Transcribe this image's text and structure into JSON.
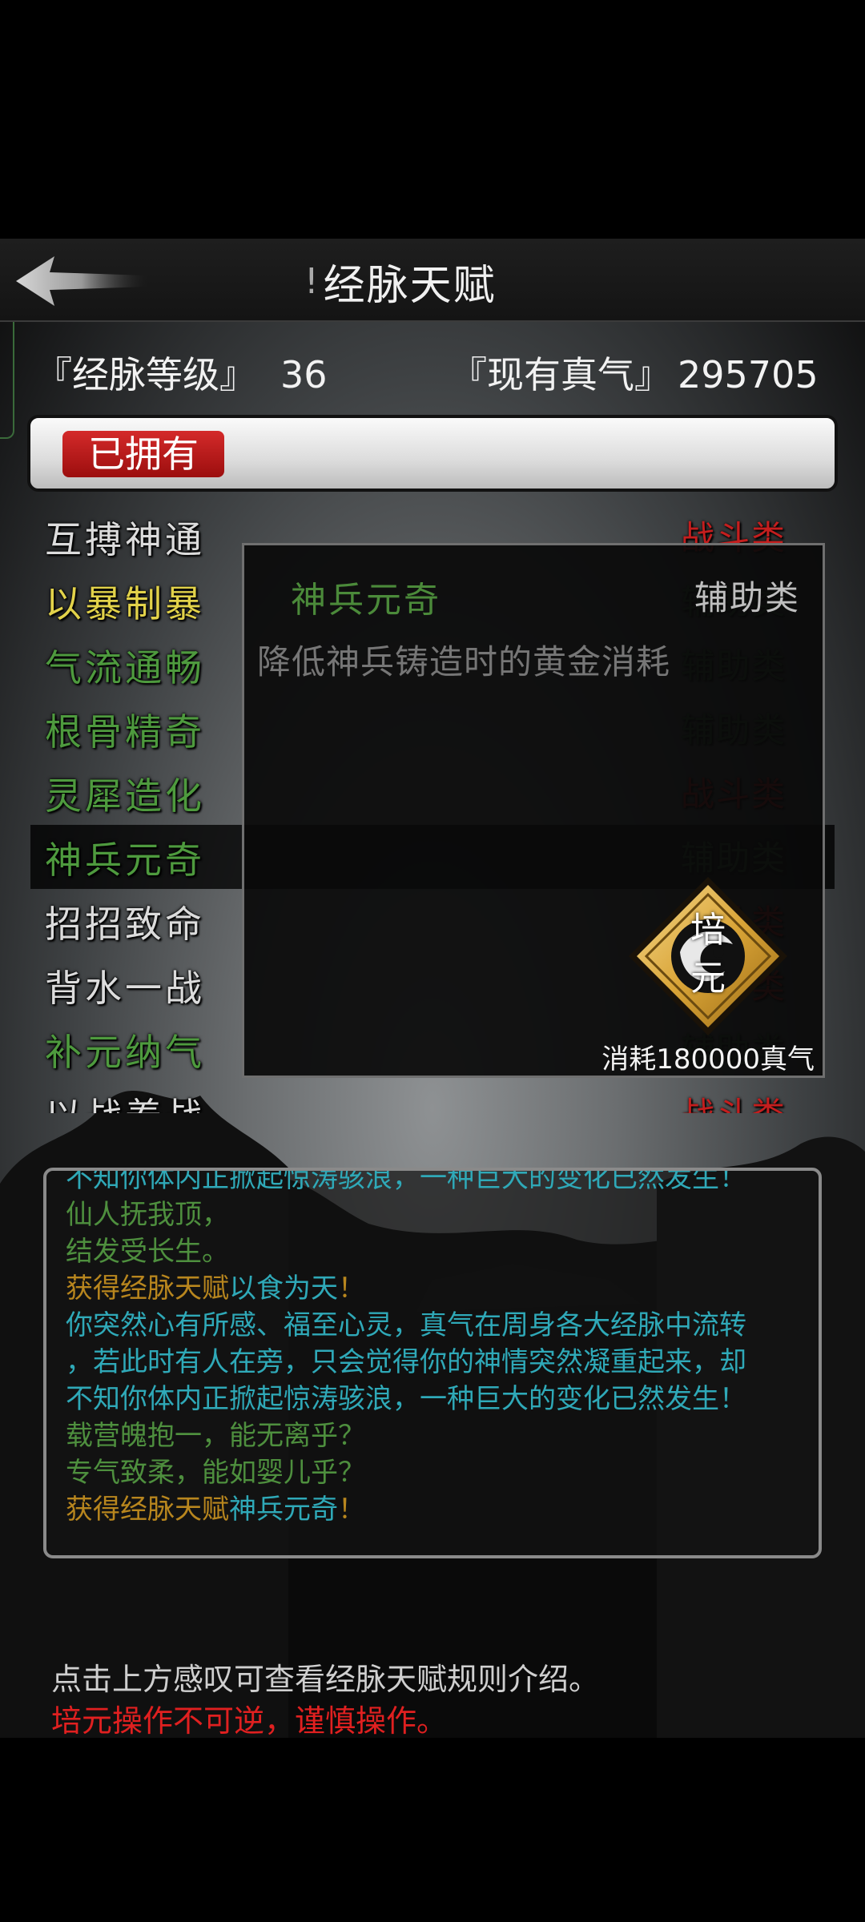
{
  "header": {
    "title": "经脉天赋",
    "info_icon": "!"
  },
  "stats": {
    "level_label": "『经脉等级』",
    "level_value": "36",
    "qi_label": "『现有真气』",
    "qi_value": "295705"
  },
  "filter": {
    "owned_label": "已拥有"
  },
  "talents": [
    {
      "name": "互搏神通",
      "category": "战斗类",
      "name_color": "#dcdcdc",
      "cat_color": "#c41e1e"
    },
    {
      "name": "以暴制暴",
      "category": "辅助类",
      "name_color": "#e2d24a",
      "cat_color": "#2e5a2e"
    },
    {
      "name": "气流通畅",
      "category": "辅助类",
      "name_color": "#4e9a3e",
      "cat_color": "#2e5a2e"
    },
    {
      "name": "根骨精奇",
      "category": "辅助类",
      "name_color": "#4e9a3e",
      "cat_color": "#2e5a2e"
    },
    {
      "name": "灵犀造化",
      "category": "战斗类",
      "name_color": "#4e9a3e",
      "cat_color": "#c41e1e"
    },
    {
      "name": "神兵元奇",
      "category": "辅助类",
      "name_color": "#4e9a3e",
      "cat_color": "#2e5a2e"
    },
    {
      "name": "招招致命",
      "category": "战斗类",
      "name_color": "#dcdcdc",
      "cat_color": "#c41e1e"
    },
    {
      "name": "背水一战",
      "category": "战斗类",
      "name_color": "#dcdcdc",
      "cat_color": "#c41e1e"
    },
    {
      "name": "补元纳气",
      "category": "辅助类",
      "name_color": "#4e9a3e",
      "cat_color": "#2e5a2e"
    },
    {
      "name": "以战养战",
      "category": "战斗类",
      "name_color": "#dcdcdc",
      "cat_color": "#c41e1e"
    }
  ],
  "selected_index": 5,
  "detail": {
    "name": "神兵元奇",
    "category": "辅助类",
    "description": "降低神兵铸造时的黄金消耗",
    "action_label_1": "培",
    "action_label_2": "元",
    "cost": "消耗180000真气"
  },
  "log": [
    {
      "text": "不知你体内正掀起惊涛骇浪，一种巨大的变化已然发生！",
      "color": "#2fa9b8"
    },
    {
      "text": "仙人抚我顶，",
      "color": "#4e8f3e"
    },
    {
      "text": "结发受长生。",
      "color": "#4e8f3e"
    },
    {
      "parts": [
        {
          "text": "获得经脉天赋",
          "color": "#b8861e"
        },
        {
          "text": "以食为天",
          "color": "#2fa9b8"
        },
        {
          "text": "！",
          "color": "#b8861e"
        }
      ]
    },
    {
      "text": "你突然心有所感、福至心灵，真气在周身各大经脉中流转",
      "color": "#2fa9b8"
    },
    {
      "text": "，若此时有人在旁，只会觉得你的神情突然凝重起来，却",
      "color": "#2fa9b8"
    },
    {
      "text": "不知你体内正掀起惊涛骇浪，一种巨大的变化已然发生！",
      "color": "#2fa9b8"
    },
    {
      "text": "载营魄抱一，能无离乎？",
      "color": "#4e8f3e"
    },
    {
      "text": "专气致柔，能如婴儿乎？",
      "color": "#4e8f3e"
    },
    {
      "parts": [
        {
          "text": "获得经脉天赋",
          "color": "#b8861e"
        },
        {
          "text": "神兵元奇",
          "color": "#2fa9b8"
        },
        {
          "text": "！",
          "color": "#b8861e"
        }
      ]
    }
  ],
  "footer": {
    "hint_info": "点击上方感叹可查看经脉天赋规则介绍。",
    "hint_warning": "培元操作不可逆，谨慎操作。"
  },
  "icons": {
    "back": "back-arrow-icon",
    "action": "peiyuan-diamond-icon"
  }
}
